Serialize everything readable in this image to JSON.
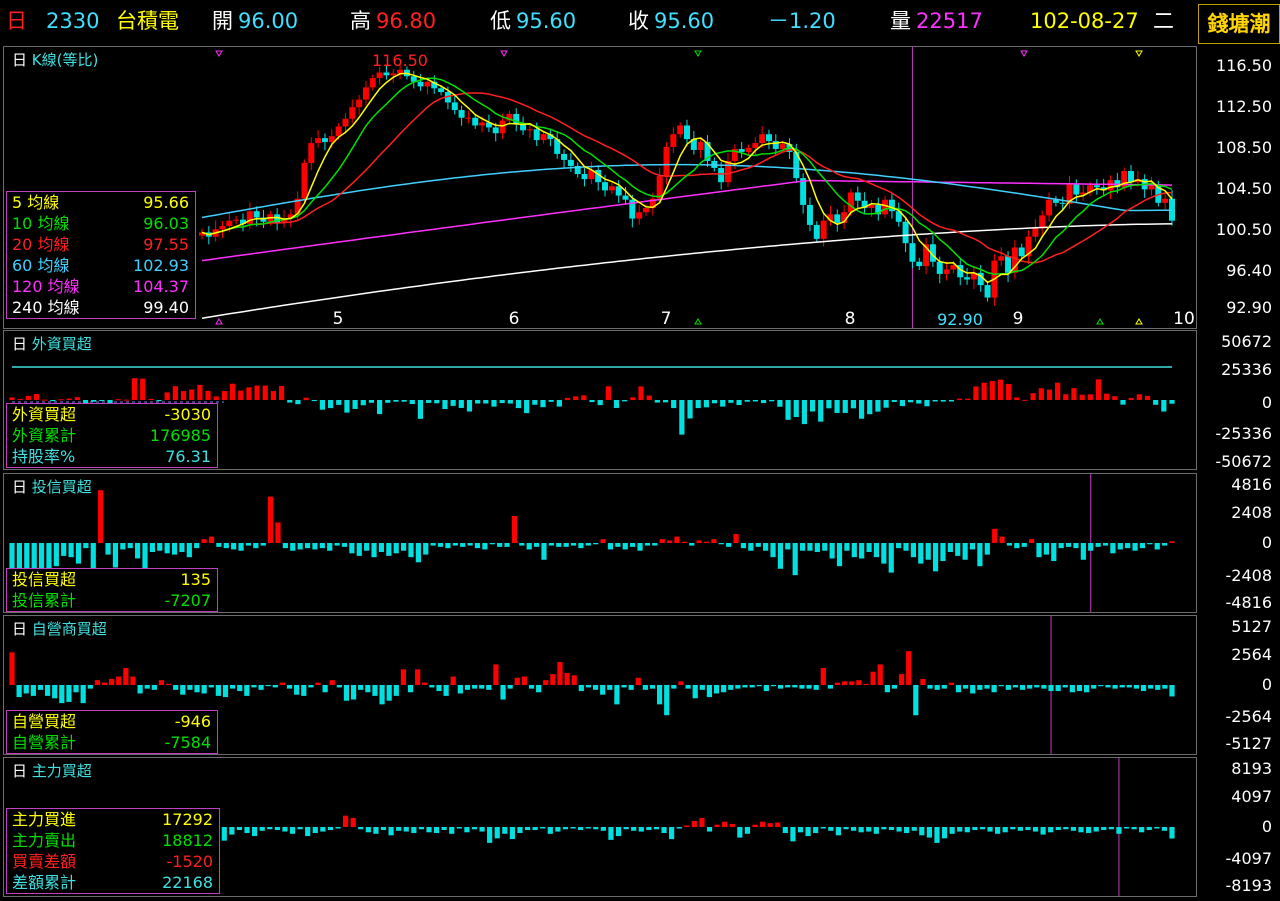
{
  "header": {
    "period": "日",
    "code": "2330",
    "name": "台積電",
    "open_label": "開",
    "open": "96.00",
    "high_label": "高",
    "high": "96.80",
    "low_label": "低",
    "low": "95.60",
    "close_label": "收",
    "close": "95.60",
    "change": "－1.20",
    "volume_label": "量",
    "volume": "22517",
    "date": "102-08-27",
    "weekday": "二",
    "brand": "錢塘潮"
  },
  "colors": {
    "up": "#ff0000",
    "down": "#00e0e0",
    "ma5": "#ffff00",
    "ma10": "#00e000",
    "ma20": "#ff2020",
    "ma60": "#40d0ff",
    "ma120": "#ff30ff",
    "ma240": "#ffffff"
  },
  "kline": {
    "period": "日",
    "title": "K線(等比)",
    "max_label": "116.50",
    "min_label": "92.90",
    "yticks": [
      "116.50",
      "112.50",
      "108.50",
      "104.50",
      "100.50",
      "96.40",
      "92.90"
    ],
    "month_labels": [
      "5",
      "6",
      "7",
      "8",
      "9",
      "10"
    ],
    "ma_legend": [
      {
        "label": "5 均線",
        "value": "95.66"
      },
      {
        "label": "10 均線",
        "value": "96.03"
      },
      {
        "label": "20 均線",
        "value": "97.55"
      },
      {
        "label": "60 均線",
        "value": "102.93"
      },
      {
        "label": "120 均線",
        "value": "104.37"
      },
      {
        "label": "240 均線",
        "value": "99.40"
      }
    ]
  },
  "foreign": {
    "period": "日",
    "title": "外資買超",
    "yticks": [
      "50672",
      "25336",
      "0",
      "-25336",
      "-50672"
    ],
    "legend": [
      {
        "label": "外資買超",
        "value": "-3030"
      },
      {
        "label": "外資累計",
        "value": "176985"
      },
      {
        "label": "持股率%",
        "value": "76.31"
      }
    ]
  },
  "trust": {
    "period": "日",
    "title": "投信買超",
    "yticks": [
      "4816",
      "2408",
      "0",
      "-2408",
      "-4816"
    ],
    "legend": [
      {
        "label": "投信買超",
        "value": "135"
      },
      {
        "label": "投信累計",
        "value": "-7207"
      }
    ]
  },
  "dealer": {
    "period": "日",
    "title": "自營商買超",
    "yticks": [
      "5127",
      "2564",
      "0",
      "-2564",
      "-5127"
    ],
    "legend": [
      {
        "label": "自營買超",
        "value": "-946"
      },
      {
        "label": "自營累計",
        "value": "-7584"
      }
    ]
  },
  "main": {
    "period": "日",
    "title": "主力買超",
    "yticks": [
      "8193",
      "4097",
      "0",
      "-4097",
      "-8193"
    ],
    "legend": [
      {
        "label": "主力買進",
        "value": "17292"
      },
      {
        "label": "主力賣出",
        "value": "18812"
      },
      {
        "label": "買賣差額",
        "value": "-1520"
      },
      {
        "label": "差額累計",
        "value": "22168"
      }
    ]
  },
  "chart_data": [
    {
      "type": "candlestick",
      "title": "K線(等比)",
      "ylim": [
        92.9,
        116.5
      ],
      "closes": [
        99.8,
        99.4,
        100.1,
        100.4,
        100.9,
        101.0,
        100.6,
        101.8,
        101.2,
        100.8,
        101.5,
        100.7,
        101.1,
        101.5,
        103.0,
        106.5,
        108.5,
        109.0,
        108.6,
        109.2,
        110.2,
        111.0,
        112.2,
        113.0,
        114.3,
        115.3,
        115.9,
        115.6,
        115.8,
        116.2,
        115.5,
        114.9,
        114.4,
        114.9,
        114.2,
        113.8,
        112.7,
        111.9,
        111.1,
        111.1,
        110.3,
        110.6,
        110.1,
        109.5,
        110.8,
        111.5,
        110.4,
        109.8,
        109.9,
        108.8,
        109.4,
        108.9,
        107.4,
        106.8,
        106.2,
        105.4,
        104.9,
        105.8,
        104.6,
        103.8,
        104.2,
        103.3,
        102.9,
        101.1,
        101.7,
        102.1,
        103.0,
        105.2,
        108.1,
        109.4,
        110.3,
        108.9,
        107.8,
        108.6,
        106.7,
        106.0,
        104.6,
        106.7,
        107.9,
        107.6,
        108.0,
        108.5,
        109.4,
        108.7,
        107.9,
        108.4,
        107.6,
        105.0,
        102.4,
        100.5,
        99.2,
        100.9,
        101.5,
        100.7,
        101.7,
        103.6,
        102.8,
        102.1,
        102.4,
        101.5,
        102.9,
        101.8,
        100.8,
        98.8,
        97.1,
        96.7,
        98.7,
        97.1,
        96.0,
        96.4,
        96.8,
        95.7,
        95.5,
        96.1,
        95.0,
        93.9,
        97.2,
        97.6,
        96.1,
        98.4,
        97.6,
        99.4,
        100.2,
        101.4,
        102.9,
        102.6,
        102.5,
        104.4,
        103.4,
        103.6,
        104.3,
        104.1,
        103.8,
        104.8,
        104.1,
        105.7,
        104.6,
        104.9,
        103.9,
        104.4,
        102.6,
        103.0,
        100.9
      ],
      "ma5_last": 95.66,
      "ma10_last": 96.03,
      "ma20_last": 97.55,
      "ma60_last": 102.93,
      "ma120_last": 104.37,
      "ma240_last": 99.4,
      "high_marker": 116.5,
      "low_marker": 92.9
    },
    {
      "type": "bar",
      "title": "外資買超",
      "ylim": [
        -50672,
        50672
      ],
      "values": [
        2100,
        800,
        3400,
        4900,
        300,
        -900,
        600,
        1200,
        2300,
        -3500,
        -1400,
        -800,
        -2600,
        600,
        300,
        17800,
        17500,
        900,
        -900,
        6200,
        11300,
        7300,
        8600,
        12400,
        7500,
        2900,
        7300,
        13300,
        7700,
        10300,
        11800,
        11800,
        7300,
        11500,
        -2100,
        -3400,
        1900,
        -900,
        -7900,
        -6600,
        -4000,
        -10300,
        -7300,
        -4300,
        -2300,
        -11500,
        -2300,
        -1400,
        -1400,
        -3300,
        -15400,
        -2400,
        -2700,
        -7400,
        -4800,
        -6500,
        -9400,
        -2900,
        -2900,
        -5400,
        -2500,
        -2900,
        -6600,
        -10700,
        -3900,
        -5900,
        -1500,
        -5400,
        1700,
        3000,
        3800,
        -1700,
        -4200,
        11200,
        -6500,
        -1100,
        2200,
        11100,
        3700,
        -2100,
        -1900,
        -6600,
        -28300,
        -15100,
        -6600,
        -6000,
        -2700,
        -5400,
        -2300,
        -4100,
        -1400,
        -1200,
        -2500,
        -1100,
        -5500,
        -16200,
        -13900,
        -19700,
        -9400,
        -17700,
        -6800,
        -10600,
        -10600,
        -6800,
        -15300,
        -11600,
        -9500,
        -6300,
        -1600,
        -5000,
        -1900,
        -2900,
        -5100,
        -1200,
        -1300,
        -1200,
        1100,
        1100,
        11100,
        14100,
        15500,
        16700,
        13100,
        2100,
        100,
        5600,
        9600,
        8500,
        14200,
        4700,
        9700,
        4300,
        4600,
        16900,
        5200,
        3100,
        -3800,
        1700,
        4700,
        3400,
        -3900,
        -9400,
        -3030
      ]
    },
    {
      "type": "bar",
      "title": "投信買超",
      "ylim": [
        -4816,
        4816
      ],
      "values": [
        -2200,
        -2100,
        -2500,
        -2300,
        -2800,
        -2600,
        -1800,
        -1000,
        -1100,
        -1600,
        -400,
        -2200,
        4100,
        -900,
        -1900,
        -500,
        -400,
        -1200,
        -2100,
        -700,
        -600,
        -800,
        -900,
        -700,
        -1100,
        -400,
        300,
        500,
        -300,
        -400,
        -500,
        -600,
        -200,
        -400,
        -200,
        3600,
        1600,
        -400,
        -600,
        -500,
        -400,
        -500,
        -400,
        -600,
        -200,
        -300,
        -800,
        -1000,
        -600,
        -1100,
        -700,
        -1000,
        -800,
        -600,
        -1100,
        -1500,
        -900,
        -200,
        -300,
        -400,
        -200,
        -300,
        -200,
        -400,
        -500,
        -100,
        -300,
        -300,
        2100,
        -200,
        -500,
        -300,
        -1300,
        -200,
        -300,
        -300,
        -200,
        -400,
        -200,
        -100,
        300,
        -500,
        -300,
        -500,
        -300,
        -600,
        -200,
        -200,
        300,
        200,
        500,
        100,
        -200,
        200,
        100,
        300,
        -100,
        -300,
        700,
        -400,
        -600,
        -300,
        -600,
        -1100,
        -2000,
        -500,
        -2500,
        -600,
        -600,
        -700,
        -600,
        -1200,
        -1800,
        -600,
        -1100,
        -1200,
        -700,
        -1100,
        -1600,
        -2300,
        -400,
        -600,
        -1100,
        -1600,
        -1300,
        -2200,
        -1400,
        -700,
        -1000,
        -1300,
        -500,
        -1800,
        -900,
        1100,
        500,
        -200,
        -400,
        -300,
        300,
        -1100,
        -900,
        -1400,
        -400,
        -300,
        -400,
        -1300,
        -600,
        -300,
        -200,
        -800,
        -500,
        -400,
        -600,
        -400,
        -100,
        -500,
        -200,
        135
      ]
    },
    {
      "type": "bar",
      "title": "自營商買超",
      "ylim": [
        -5127,
        5127
      ],
      "values": [
        2700,
        -1000,
        -700,
        -900,
        -400,
        -900,
        -1100,
        -1500,
        -1400,
        -600,
        -1500,
        -300,
        400,
        200,
        500,
        700,
        1400,
        700,
        -700,
        -300,
        -400,
        400,
        100,
        -400,
        -800,
        -400,
        -600,
        -700,
        -200,
        -900,
        -1000,
        -300,
        -500,
        -900,
        -200,
        -400,
        -100,
        -200,
        200,
        -300,
        -800,
        -900,
        -200,
        200,
        -600,
        400,
        -200,
        -1300,
        -1200,
        -400,
        -600,
        -900,
        -1600,
        -1300,
        -900,
        1300,
        -600,
        1300,
        200,
        -200,
        -500,
        -900,
        700,
        -700,
        -400,
        -300,
        -300,
        -400,
        1700,
        -1200,
        -300,
        600,
        700,
        -300,
        -600,
        400,
        900,
        1900,
        1000,
        800,
        -500,
        -200,
        -400,
        -800,
        -400,
        -1600,
        -200,
        -400,
        600,
        -400,
        -300,
        -1600,
        -2500,
        -300,
        300,
        -300,
        -1100,
        -400,
        -1000,
        -700,
        -600,
        -400,
        -300,
        -200,
        -200,
        -100,
        -500,
        -100,
        -300,
        -200,
        -200,
        -300,
        -300,
        -400,
        1400,
        -300,
        200,
        300,
        300,
        400,
        100,
        1100,
        1700,
        -600,
        -300,
        900,
        2800,
        -2500,
        500,
        -300,
        -400,
        -300,
        200,
        -600,
        -300,
        -700,
        -400,
        -300,
        -600,
        -100,
        -400,
        -200,
        -400,
        -300,
        -200,
        -300,
        -500,
        -500,
        -200,
        -600,
        -500,
        -600,
        -300,
        -100,
        -200,
        -300,
        -200,
        -200,
        -300,
        -500,
        -300,
        -400,
        -300,
        -946
      ]
    },
    {
      "type": "bar",
      "title": "主力買超",
      "ylim": [
        -8193,
        8193
      ],
      "values": [
        500,
        1500,
        1200,
        800,
        -500,
        -800,
        -300,
        -1100,
        -900,
        -800,
        -400,
        -600,
        -700,
        -500,
        1800,
        -400,
        -300,
        -600,
        -300,
        -400,
        -200,
        -800,
        -600,
        -700,
        -400,
        -300,
        -500,
        -200,
        -1800,
        -1000,
        -400,
        -800,
        -1200,
        -500,
        -300,
        -400,
        -600,
        -900,
        -300,
        -1200,
        -800,
        -600,
        -400,
        -200,
        1500,
        1200,
        -300,
        -700,
        -900,
        -400,
        -1100,
        -500,
        -600,
        -800,
        -300,
        -700,
        -800,
        -400,
        -900,
        -200,
        -700,
        -300,
        -600,
        -2100,
        -1500,
        -900,
        -1600,
        -800,
        -400,
        -400,
        -200,
        -900,
        -600,
        -300,
        -200,
        -400,
        -200,
        -300,
        -500,
        -1700,
        -1200,
        -300,
        -500,
        -600,
        -400,
        -300,
        -800,
        -1600,
        -200,
        200,
        800,
        1200,
        -600,
        300,
        700,
        400,
        -1400,
        -900,
        300,
        700,
        500,
        600,
        -800,
        -1900,
        -700,
        -1200,
        -800,
        -200,
        -500,
        -1100,
        -300,
        -500,
        -700,
        -600,
        -900,
        -300,
        -400,
        -600,
        -800,
        -500,
        -1100,
        -1400,
        -2100,
        -1500,
        -900,
        -600,
        -700,
        -400,
        -300,
        -600,
        -900,
        -700,
        -300,
        -500,
        -400,
        -600,
        -1000,
        -700,
        -400,
        -300,
        -500,
        -700,
        -800,
        -600,
        -400,
        -300,
        -900,
        -200,
        -300,
        -700,
        -400,
        -200,
        -500,
        -1520
      ]
    }
  ]
}
